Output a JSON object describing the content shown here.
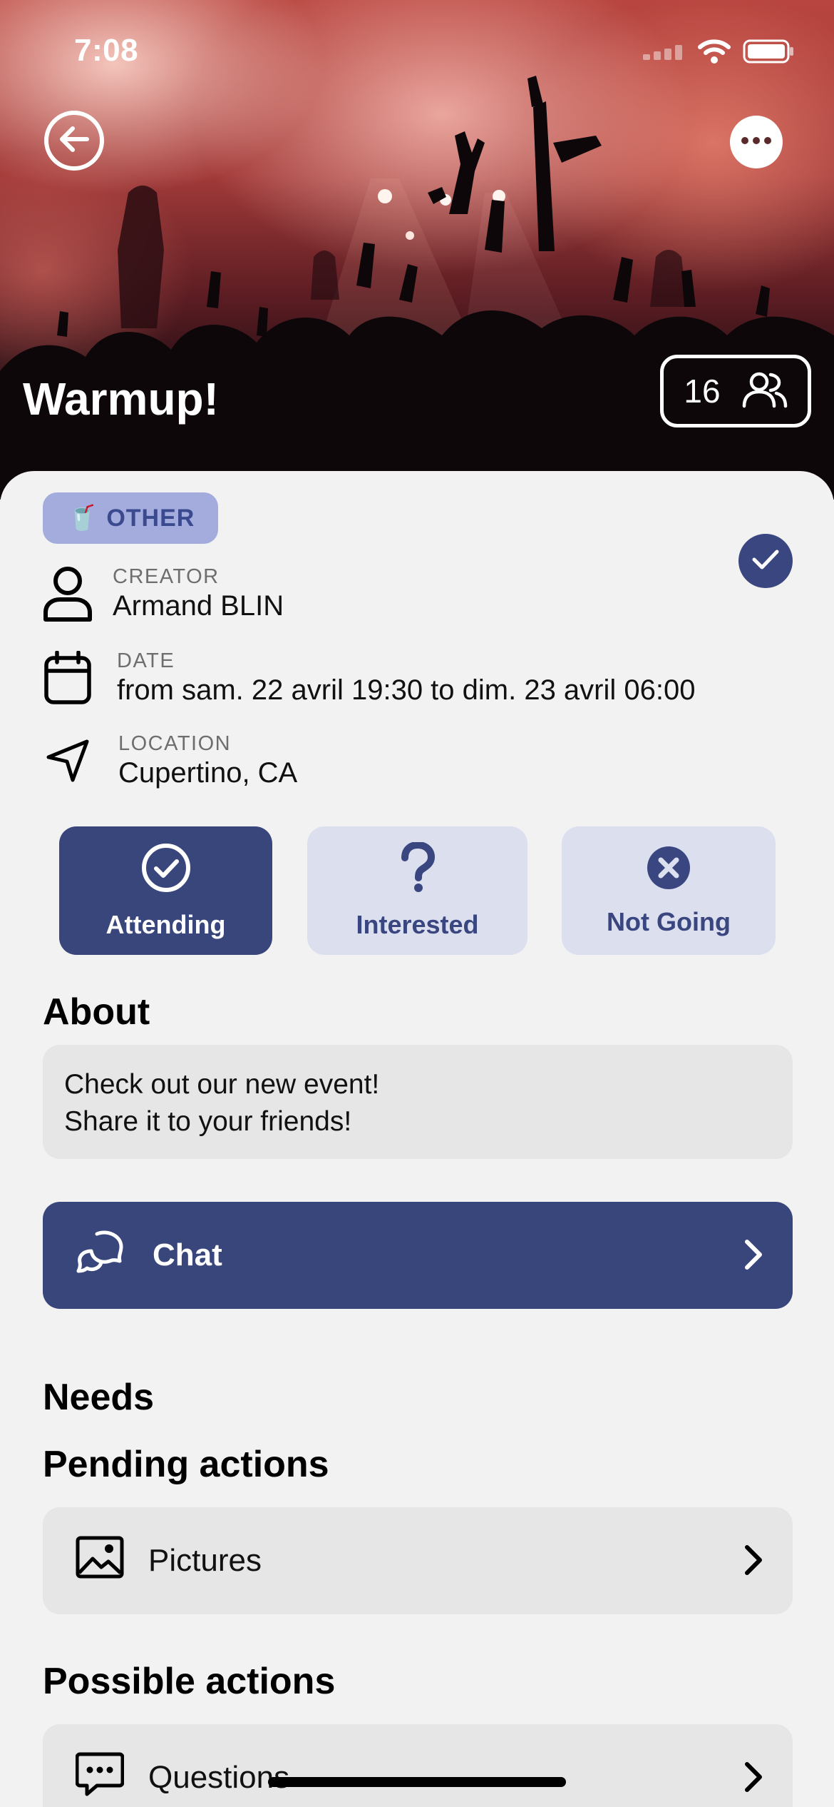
{
  "status_bar": {
    "time": "7:08"
  },
  "event": {
    "title": "Warmup!",
    "attendee_count": "16",
    "category": {
      "emoji": "🥤",
      "label": "OTHER"
    }
  },
  "details": {
    "creator": {
      "label": "CREATOR",
      "value": "Armand BLIN"
    },
    "date": {
      "label": "DATE",
      "value": "from sam. 22 avril 19:30 to dim. 23 avril 06:00"
    },
    "location": {
      "label": "LOCATION",
      "value": "Cupertino, CA"
    }
  },
  "rsvp": {
    "attending": "Attending",
    "interested": "Interested",
    "not_going": "Not Going",
    "selected": "attending"
  },
  "about": {
    "heading": "About",
    "line1": "Check out our new event!",
    "line2": "Share it to your friends!"
  },
  "chat": {
    "label": "Chat"
  },
  "needs": {
    "heading": "Needs",
    "pending_heading": "Pending actions",
    "pending": [
      {
        "label": "Pictures",
        "icon": "image-icon"
      }
    ],
    "possible_heading": "Possible actions",
    "possible": [
      {
        "label": "Questions",
        "icon": "message-dots-icon"
      }
    ]
  },
  "colors": {
    "accent": "#39467c",
    "tag_bg": "#a3acdd",
    "idle_button_bg": "#dcdfee",
    "card_bg": "#e6e6e6",
    "page_bg": "#f2f2f2"
  }
}
